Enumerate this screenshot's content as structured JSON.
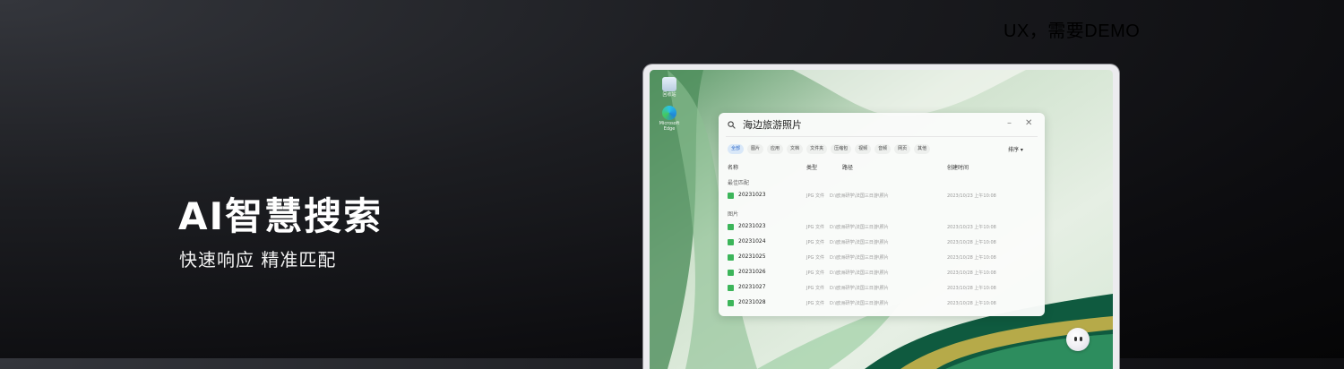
{
  "corner_label": "UX，需要DEMO",
  "hero": {
    "title": "AI智慧搜索",
    "subtitle": "快速响应 精准匹配"
  },
  "desktop": {
    "icons": [
      {
        "name": "recycle-bin",
        "label": "回收站"
      },
      {
        "name": "edge",
        "label": "Microsoft Edge"
      }
    ]
  },
  "search": {
    "query": "海边旅游照片",
    "filters": [
      "全部",
      "图片",
      "应用",
      "文档",
      "文件夹",
      "压缩包",
      "视频",
      "音频",
      "网页",
      "其他"
    ],
    "active_filter": "全部",
    "sort_label": "排序 ▾",
    "columns": {
      "name": "名称",
      "type": "类型",
      "path": "路径",
      "created": "创建时间"
    },
    "best_match_label": "最佳匹配",
    "best_match": {
      "name": "20231023",
      "type": "JPG 文件",
      "path": "D:\\欧洲研学\\法国三日游\\照片",
      "time": "2023/10/23 上午10:08"
    },
    "images_label": "图片",
    "images": [
      {
        "name": "20231023",
        "type": "JPG 文件",
        "path": "D:\\欧洲研学\\法国三日游\\照片",
        "time": "2023/10/23 上午10:08"
      },
      {
        "name": "20231024",
        "type": "JPG 文件",
        "path": "D:\\欧洲研学\\法国三日游\\照片",
        "time": "2023/10/28 上午10:08"
      },
      {
        "name": "20231025",
        "type": "JPG 文件",
        "path": "D:\\欧洲研学\\法国三日游\\照片",
        "time": "2023/10/28 上午10:08"
      },
      {
        "name": "20231026",
        "type": "JPG 文件",
        "path": "D:\\欧洲研学\\法国三日游\\照片",
        "time": "2023/10/28 上午10:08"
      },
      {
        "name": "20231027",
        "type": "JPG 文件",
        "path": "D:\\欧洲研学\\法国三日游\\照片",
        "time": "2023/10/28 上午10:08"
      },
      {
        "name": "20231028",
        "type": "JPG 文件",
        "path": "D:\\欧洲研学\\法国三日游\\照片",
        "time": "2023/10/28 上午10:08"
      }
    ]
  }
}
